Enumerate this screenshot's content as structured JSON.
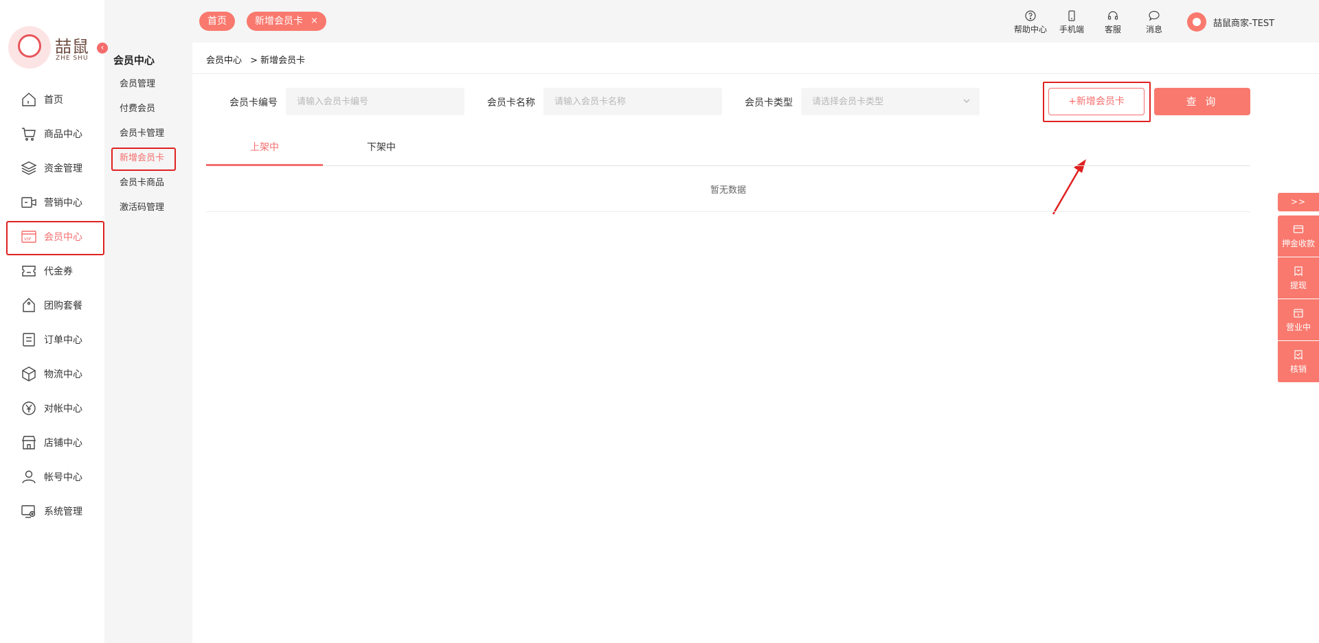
{
  "brand": {
    "name_cn": "喆鼠",
    "name_en": "ZHE SHU"
  },
  "header": {
    "tabs": [
      {
        "label": "首页"
      },
      {
        "label": "新增会员卡",
        "close": "×"
      }
    ],
    "tools": [
      {
        "label": "帮助中心",
        "icon": "help-icon"
      },
      {
        "label": "手机端",
        "icon": "phone-icon"
      },
      {
        "label": "客服",
        "icon": "headset-icon"
      },
      {
        "label": "消息",
        "icon": "message-icon"
      }
    ],
    "user": {
      "name": "喆鼠商家-TEST"
    }
  },
  "nav": {
    "items": [
      {
        "label": "首页",
        "icon": "home-icon"
      },
      {
        "label": "商品中心",
        "icon": "cart-icon"
      },
      {
        "label": "资金管理",
        "icon": "layers-icon"
      },
      {
        "label": "营销中心",
        "icon": "marketing-icon"
      },
      {
        "label": "会员中心",
        "icon": "vip-icon"
      },
      {
        "label": "代金券",
        "icon": "coupon-icon"
      },
      {
        "label": "团购套餐",
        "icon": "tag-icon"
      },
      {
        "label": "订单中心",
        "icon": "order-icon"
      },
      {
        "label": "物流中心",
        "icon": "box-icon"
      },
      {
        "label": "对帐中心",
        "icon": "yen-icon"
      },
      {
        "label": "店铺中心",
        "icon": "store-icon"
      },
      {
        "label": "帐号中心",
        "icon": "user-icon"
      },
      {
        "label": "系统管理",
        "icon": "settings-icon"
      }
    ],
    "active": "会员中心"
  },
  "subnav": {
    "title": "会员中心",
    "items": [
      {
        "label": "会员管理"
      },
      {
        "label": "付费会员"
      },
      {
        "label": "会员卡管理"
      },
      {
        "label": "新增会员卡"
      },
      {
        "label": "会员卡商品"
      },
      {
        "label": "激活码管理"
      }
    ],
    "active": "新增会员卡"
  },
  "breadcrumb": {
    "root": "会员中心",
    "current": "> 新增会员卡"
  },
  "filters": {
    "card_no": {
      "label": "会员卡编号",
      "placeholder": "请输入会员卡编号",
      "value": ""
    },
    "card_name": {
      "label": "会员卡名称",
      "placeholder": "请输入会员卡名称",
      "value": ""
    },
    "card_type": {
      "label": "会员卡类型",
      "placeholder": "请选择会员卡类型",
      "value": ""
    }
  },
  "actions": {
    "add_label": "+新增会员卡",
    "query_label": "查 询"
  },
  "tabs": [
    {
      "label": "上架中",
      "active": true
    },
    {
      "label": "下架中",
      "active": false
    }
  ],
  "table": {
    "empty_text": "暂无数据"
  },
  "float_panel": {
    "toggle": ">>",
    "items": [
      {
        "label": "押金收款",
        "icon": "card-icon"
      },
      {
        "label": "提现",
        "icon": "withdraw-icon"
      },
      {
        "label": "营业中",
        "icon": "shop-open-icon"
      },
      {
        "label": "核销",
        "icon": "verify-icon"
      }
    ]
  },
  "colors": {
    "accent": "#f9796e",
    "highlight": "#e02020",
    "active_text": "#f56c6c"
  }
}
